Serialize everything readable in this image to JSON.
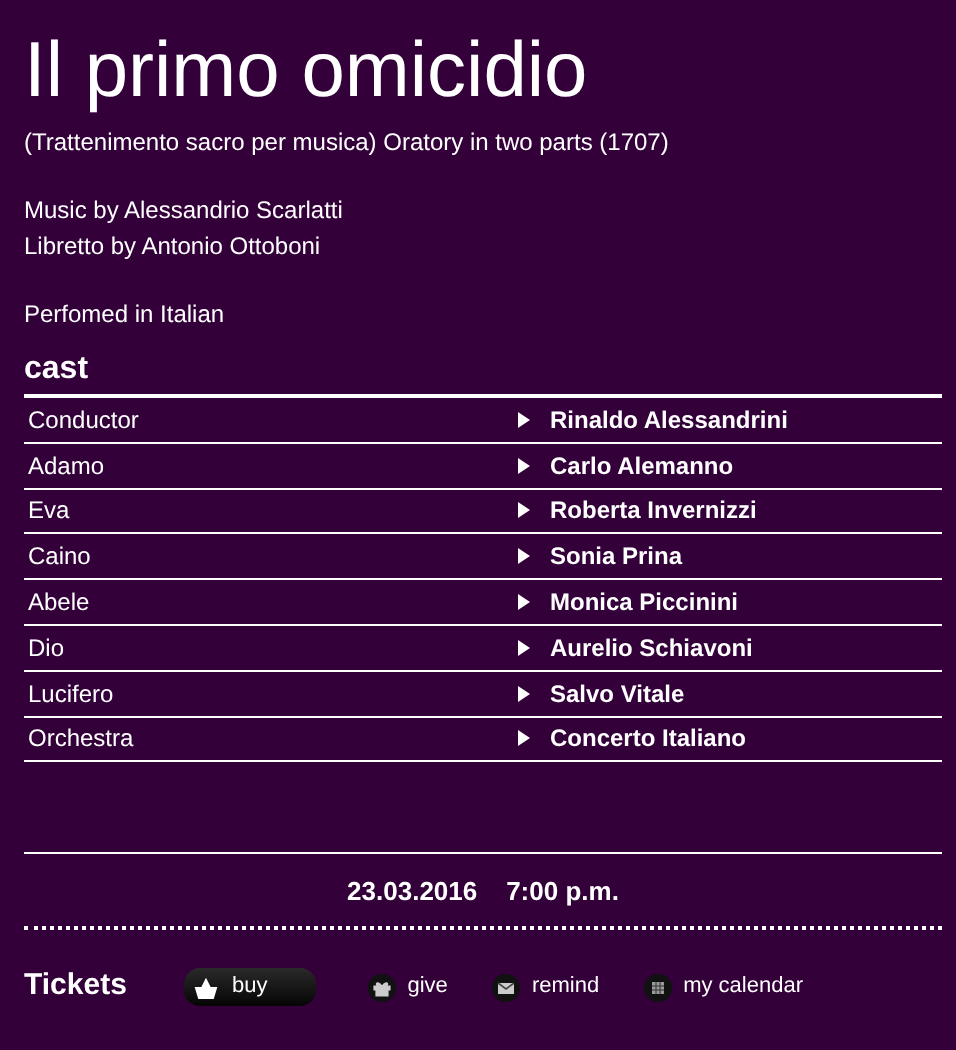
{
  "title": "Il primo omicidio",
  "subtitle": "(Trattenimento sacro per musica) Oratory in two parts (1707)",
  "credits": [
    "Music by Alessandrio Scarlatti",
    "Libretto by Antonio Ottoboni"
  ],
  "language": "Perfomed in Italian",
  "cast_heading": "cast",
  "cast": [
    {
      "role": "Conductor",
      "performer": "Rinaldo Alessandrini"
    },
    {
      "role": "Adamo",
      "performer": "Carlo Alemanno"
    },
    {
      "role": "Eva",
      "performer": "Roberta Invernizzi"
    },
    {
      "role": "Caino",
      "performer": "Sonia Prina"
    },
    {
      "role": "Abele",
      "performer": "Monica Piccinini"
    },
    {
      "role": "Dio",
      "performer": "Aurelio Schiavoni"
    },
    {
      "role": "Lucifero",
      "performer": "Salvo Vitale"
    },
    {
      "role": "Orchestra",
      "performer": "Concerto Italiano"
    }
  ],
  "date": "23.03.2016",
  "time": "7:00 p.m.",
  "tickets_label": "Tickets",
  "actions": [
    {
      "kind": "buy",
      "label": "buy"
    },
    {
      "kind": "give",
      "label": "give"
    },
    {
      "kind": "remind",
      "label": "remind"
    },
    {
      "kind": "calendar",
      "label": "my calendar"
    }
  ]
}
